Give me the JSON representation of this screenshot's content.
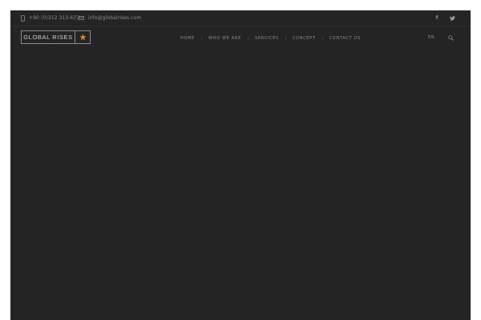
{
  "topbar": {
    "phone": "+90 (0)312 313-672",
    "email": "info@globalrises.com",
    "social": {
      "facebook_glyph": "f",
      "facebook_icon": "facebook-icon",
      "twitter_icon": "twitter-icon"
    }
  },
  "header": {
    "logo_text": "GLOBAL RISES",
    "logo_icon": "star-icon",
    "nav": [
      {
        "label": "HOME"
      },
      {
        "label": "WHO WE ARE"
      },
      {
        "label": "SERVICES"
      },
      {
        "label": "CONCEPT"
      },
      {
        "label": "CONTACT US"
      }
    ],
    "language": "EN",
    "search_icon": "search-icon"
  },
  "colors": {
    "background": "#242424",
    "accent_star": "#c8892e",
    "text_muted": "#8e8e8e"
  }
}
